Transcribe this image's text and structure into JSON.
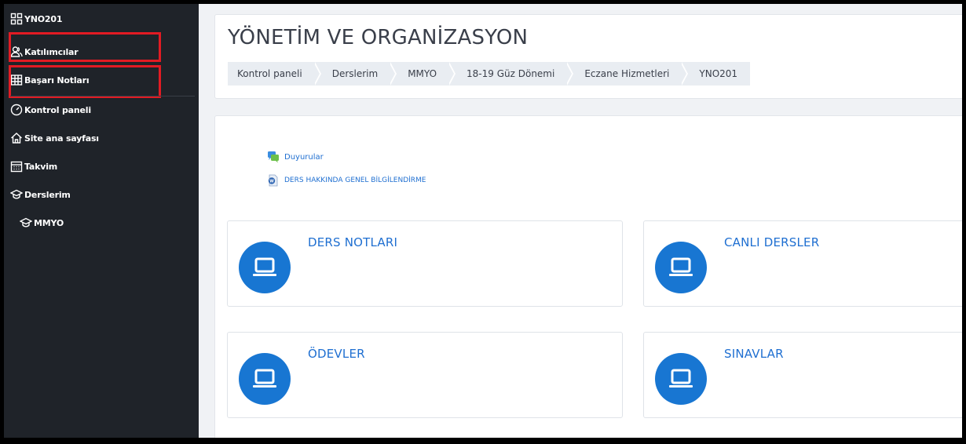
{
  "sidebar": {
    "course_code": "YNO201",
    "items": [
      {
        "label": "Katılımcılar",
        "icon": "users-icon"
      },
      {
        "label": "Başarı Notları",
        "icon": "grades-table-icon"
      },
      {
        "label": "Kontrol paneli",
        "icon": "dashboard-gauge-icon"
      },
      {
        "label": "Site ana sayfası",
        "icon": "home-icon"
      },
      {
        "label": "Takvim",
        "icon": "calendar-icon"
      },
      {
        "label": "Derslerim",
        "icon": "graduation-cap-icon"
      },
      {
        "label": "MMYO",
        "icon": "graduation-cap-icon"
      }
    ],
    "highlight_color": "#e21b23"
  },
  "header": {
    "title": "YÖNETİM VE ORGANİZASYON",
    "breadcrumb": [
      "Kontrol paneli",
      "Derslerim",
      "MMYO",
      "18-19 Güz Dönemi",
      "Eczane Hizmetleri",
      "YNO201"
    ]
  },
  "main": {
    "links": [
      {
        "label": "Duyurular",
        "icon": "forum-icon"
      },
      {
        "label": "DERS HAKKINDA GENEL BİLGİLENDİRME",
        "icon": "word-document-icon"
      }
    ],
    "sections": [
      {
        "title": "DERS NOTLARI",
        "icon": "laptop-icon"
      },
      {
        "title": "CANLI DERSLER",
        "icon": "laptop-icon"
      },
      {
        "title": "ÖDEVLER",
        "icon": "laptop-icon"
      },
      {
        "title": "SINAVLAR",
        "icon": "laptop-icon"
      }
    ],
    "accent_color": "#1876d2"
  }
}
